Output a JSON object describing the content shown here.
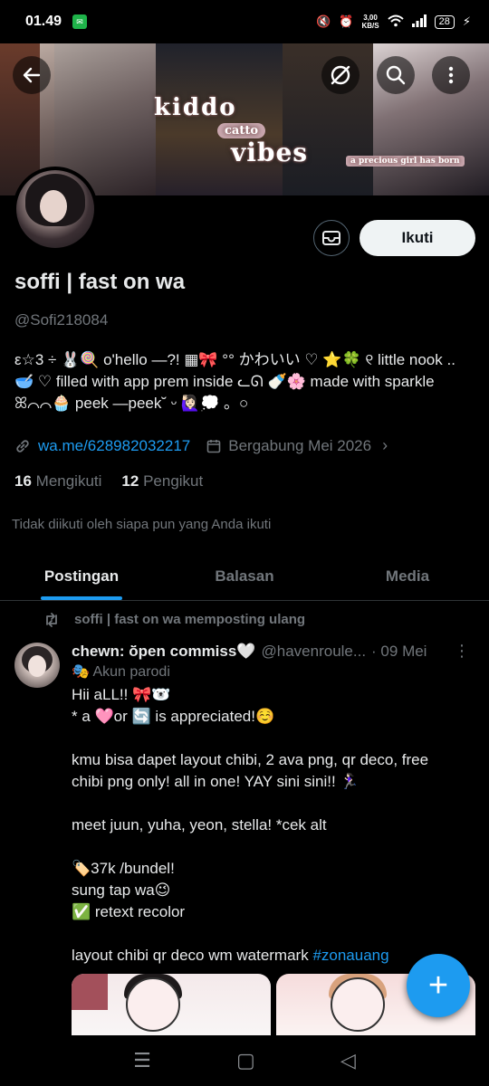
{
  "status_bar": {
    "time": "01.49",
    "net_speed": "3,00",
    "net_unit": "KB/S",
    "battery": "28"
  },
  "banner": {
    "kiddo": "kiddo",
    "catto": "catto",
    "vibes": "vibes",
    "tagline": "a precious girl has born"
  },
  "header": {
    "back_icon": "back-arrow-icon",
    "grok_icon": "slash-circle-icon",
    "search_icon": "search-icon",
    "more_icon": "more-vertical-icon"
  },
  "profile": {
    "name": "soffi | fast on wa",
    "handle": "@Sofi218084",
    "bio_lines": [
      "ε☆3 ÷ 🐰🍭 o'hello —?! ▦🎀 °° かわいい ♡  ⭐🍀 ୧ little nook ..",
      "🥣 ♡ filled with app prem inside ᓚᘏ 🍼🌸 made with sparkle",
      "ꕤ⌒⌒🧁  peek —peek˘ ᵕ 🙋🏻‍♀️💭 。○"
    ],
    "link": "wa.me/628982032217",
    "joined": "Bergabung Mei 2026",
    "following_count": "16",
    "following_label": "Mengikuti",
    "followers_count": "12",
    "followers_label": "Pengikut",
    "not_followed": "Tidak diikuti oleh siapa pun yang Anda ikuti",
    "follow_button": "Ikuti"
  },
  "tabs": [
    "Postingan",
    "Balasan",
    "Media"
  ],
  "post": {
    "repost_label": "soffi | fast on wa memposting ulang",
    "author_name": "chewn: ŏ̈pen commiss🤍",
    "author_handle": "@havenroule...",
    "date": "· 09 Mei",
    "parody": "🎭 Akun parodi",
    "lines": [
      "Hii aLL!! 🎀🐻‍❄️",
      "* a 🩷or 🔄 is appreciated!☺️",
      "",
      "kmu bisa dapet layout chibi, 2 ava png, qr deco, free",
      "chibi png only! all in one! YAY sini sini!! 🏃🏻‍♀️",
      "",
      "meet juun, yuha, yeon, stella! *cek alt",
      "",
      "🏷️37k /bundel!",
      "sung tap wa😉",
      "✅ retext recolor",
      ""
    ],
    "last_line_text": "layout chibi qr deco wm watermark ",
    "hashtag": "#zonauang"
  },
  "fab_label": "+",
  "colors": {
    "accent": "#1d9bf0",
    "bg": "#000000",
    "text": "#e7e9ea",
    "muted": "#71767b"
  }
}
